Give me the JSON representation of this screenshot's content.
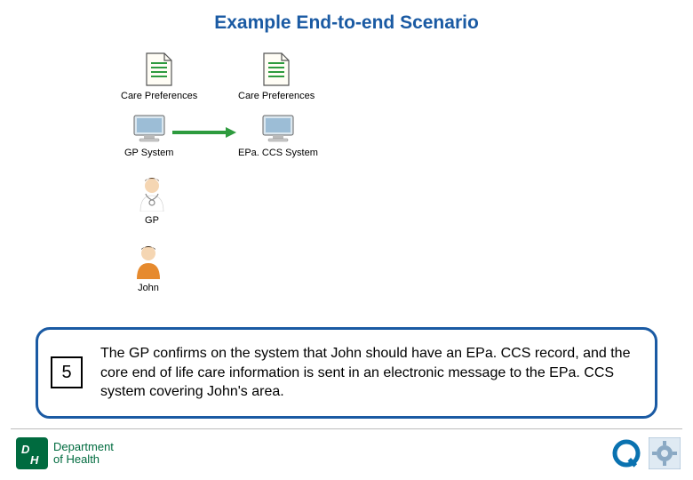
{
  "title": "Example End-to-end Scenario",
  "nodes": {
    "doc1_label": "Care Preferences",
    "doc2_label": "Care Preferences",
    "sys1_label": "GP System",
    "sys2_label": "EPa. CCS System",
    "gp_label": "GP",
    "john_label": "John"
  },
  "callout": {
    "number": "5",
    "text": "The GP confirms on the system that John should have an EPa. CCS record, and the core end of life care information is sent in an electronic message to the EPa. CCS system covering John's area."
  },
  "footer": {
    "dept_line1": "Department",
    "dept_line2": "of Health"
  }
}
